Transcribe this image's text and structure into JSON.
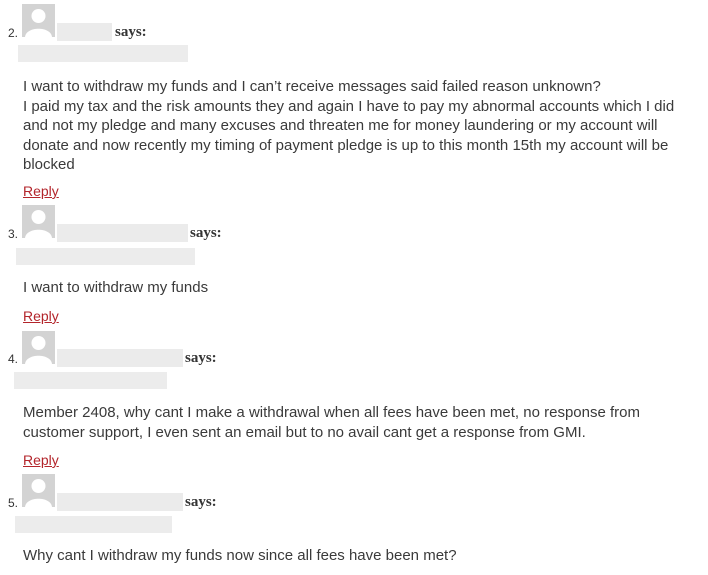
{
  "comments": [
    {
      "number": "2.",
      "says": "says:",
      "body": "I want to withdraw my funds and I can’t receive messages said failed reason unknown?\nI paid my tax and the risk amounts they and again I have to pay my abnormal accounts which I did and not my pledge and many excuses and threaten me for money laundering or my account will donate and now recently my timing of payment pledge is up to this month 15th my account will be blocked",
      "reply": "Reply"
    },
    {
      "number": "3.",
      "says": "says:",
      "body": "I want to withdraw my funds",
      "reply": "Reply"
    },
    {
      "number": "4.",
      "says": "says:",
      "body": "Member 2408, why cant I make a withdrawal when all fees have been met, no response from customer support, I even sent an email but to no avail cant get a response from GMI.",
      "reply": "Reply"
    },
    {
      "number": "5.",
      "says": "says:",
      "body": "Why cant I withdraw my funds now since all fees have been met?"
    }
  ]
}
